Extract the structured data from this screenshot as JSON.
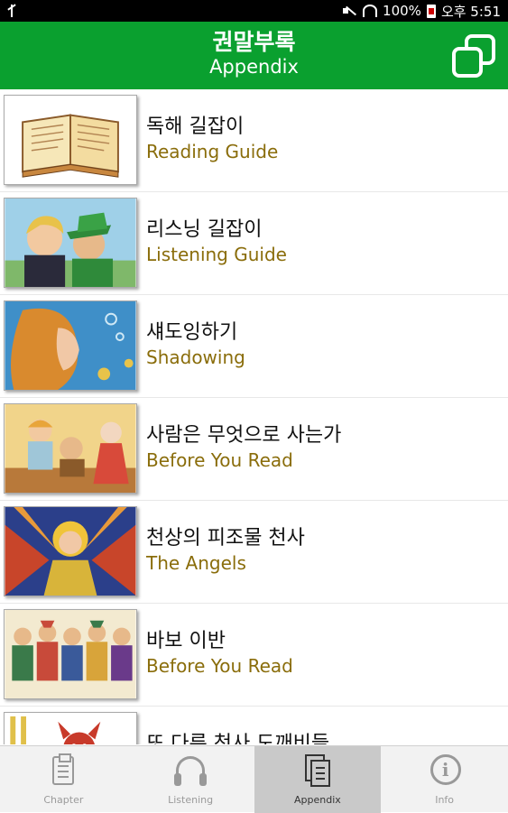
{
  "status_bar": {
    "battery_text": "100%",
    "time": "오후 5:51",
    "icons": [
      "usb-icon",
      "mute-icon",
      "wifi-icon",
      "battery-icon"
    ]
  },
  "header": {
    "title_ko": "권말부록",
    "title_en": "Appendix",
    "action_icon": "copy-icon",
    "color": "#0aa02f"
  },
  "list": {
    "items": [
      {
        "ko": "독해 길잡이",
        "en": "Reading Guide",
        "thumb": "open-book"
      },
      {
        "ko": "리스닝 길잡이",
        "en": "Listening Guide",
        "thumb": "two-boys"
      },
      {
        "ko": "섀도잉하기",
        "en": "Shadowing",
        "thumb": "girl-underwater"
      },
      {
        "ko": "사람은 무엇으로 사는가",
        "en": "Before You Read",
        "thumb": "shoemaker"
      },
      {
        "ko": "천상의 피조물 천사",
        "en": "The Angels",
        "thumb": "angel-window"
      },
      {
        "ko": "바보 이반",
        "en": "Before You Read",
        "thumb": "crowd"
      },
      {
        "ko": "또 다른 천사 도깨비들",
        "en": "",
        "thumb": "devil"
      }
    ],
    "subtitle_color": "#8a6d0b"
  },
  "nav": {
    "tabs": [
      {
        "label": "Chapter",
        "icon": "clipboard-icon",
        "active": false
      },
      {
        "label": "Listening",
        "icon": "headphones-icon",
        "active": false
      },
      {
        "label": "Appendix",
        "icon": "pages-icon",
        "active": true
      },
      {
        "label": "Info",
        "icon": "info-icon",
        "active": false
      }
    ]
  }
}
